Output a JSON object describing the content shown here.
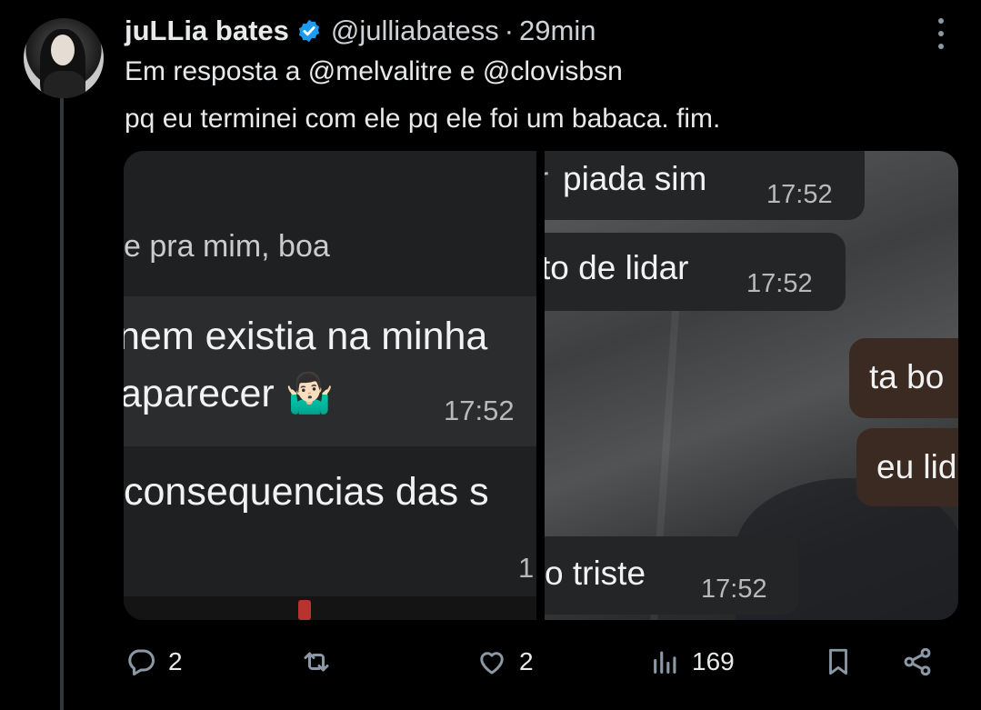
{
  "tweet": {
    "author_name": "juLLia bates",
    "handle": "@julliabatess",
    "separator": "·",
    "time": "29min",
    "reply_to": "Em resposta a @melvalitre e @clovisbsn",
    "text": "pq eu terminei com ele pq ele foi um babaca. fim."
  },
  "media": {
    "left": {
      "line1": "e pra mim, boa",
      "msg1_line1": "nem existia na minha",
      "msg1_line2": "aparecer 🤷🏻‍♂️",
      "msg1_time": "17:52",
      "msg2_line1": "consequencias das s",
      "msg2_time_partial": "1"
    },
    "right": {
      "bubble1_text": "piada sim",
      "bubble1_prefix": "r",
      "bubble1_time": "17:52",
      "bubble2_text": "to de lidar",
      "bubble2_time": "17:52",
      "bubble3_text": "ta bo",
      "bubble4_text": "eu lid",
      "bubble5_text": "o triste",
      "bubble5_time": "17:52"
    }
  },
  "actions": {
    "replies": "2",
    "retweets": "",
    "likes": "2",
    "views": "169"
  },
  "colors": {
    "background": "#000000",
    "text": "#e7e9ea",
    "muted": "#8b98a5",
    "verified": "#1d9bf0"
  }
}
